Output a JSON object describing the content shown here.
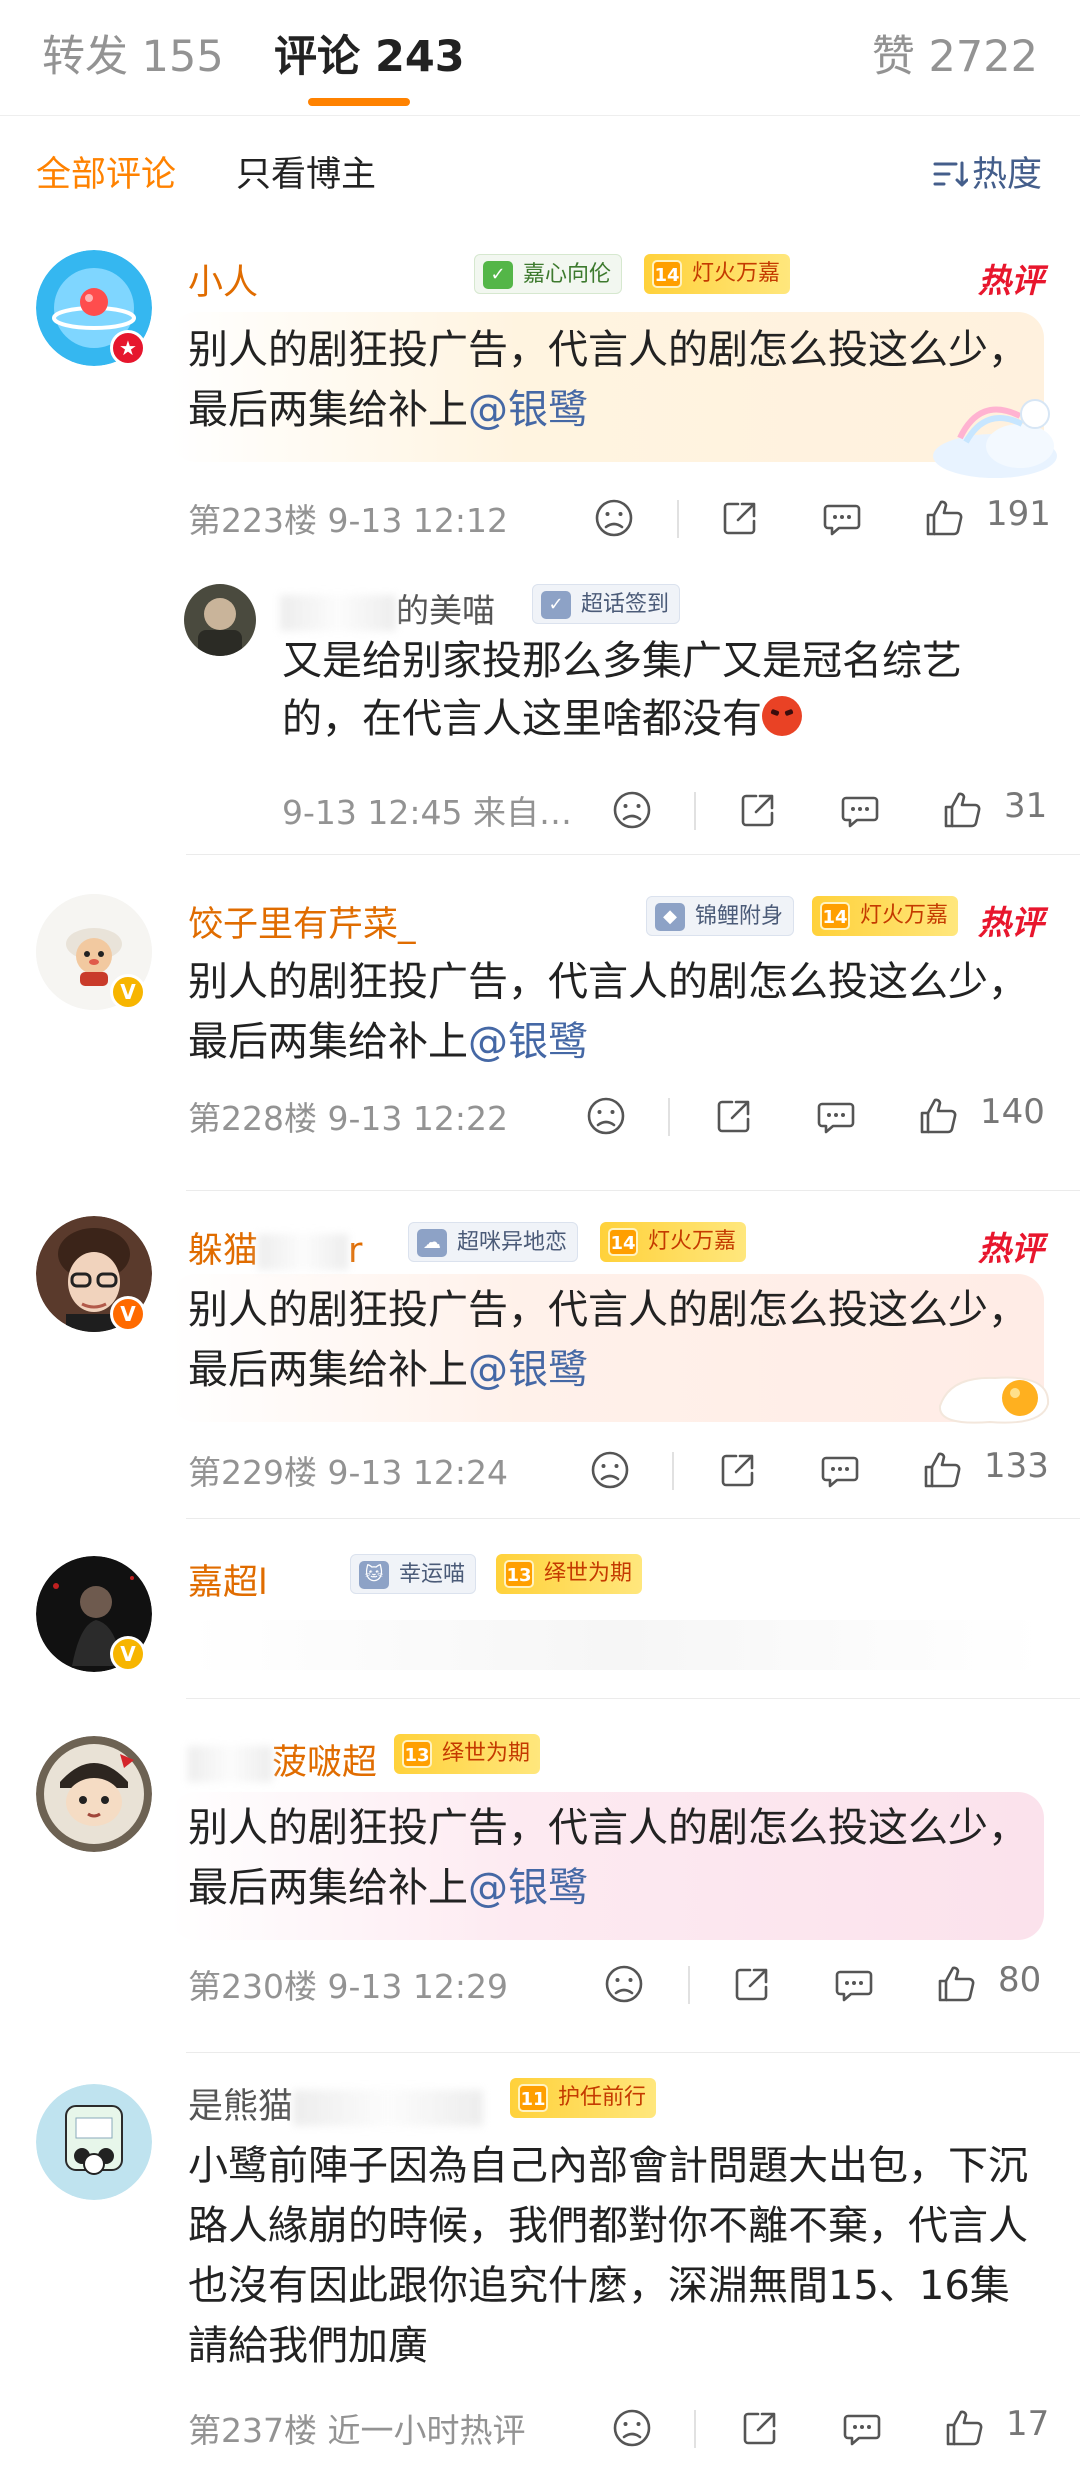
{
  "tabs": {
    "forward": "转发 155",
    "comments": "评论 243",
    "likes": "赞 2722"
  },
  "filter": {
    "all": "全部评论",
    "owner_only": "只看博主",
    "sort": "热度"
  },
  "mention": "@银鹭",
  "comments": [
    {
      "user": "小人",
      "tags": [
        {
          "icon": "check-calendar-icon",
          "label": "嘉心向伦",
          "style": "green"
        },
        {
          "icon": "level-14-icon",
          "level": "14",
          "label": "灯火万嘉",
          "style": "fire"
        }
      ],
      "hot_badge": "热评",
      "text_before": "别人的剧狂投广告，代言人的剧怎么投这么少，最后两集给补上",
      "floor": "第223楼",
      "time": "9-13 12:12",
      "likes": "191",
      "reply": {
        "user_visible": "的美喵",
        "tag": "超话签到",
        "text": "又是给别家投那么多集广又是冠名综艺的，在代言人这里啥都没有",
        "time": "9-13 12:45",
        "source": "来自…",
        "likes": "31"
      }
    },
    {
      "user": "饺子里有芹菜_",
      "tags": [
        {
          "icon": "koi-icon",
          "label": "锦鲤附身",
          "style": "gray"
        },
        {
          "icon": "level-14-icon",
          "level": "14",
          "label": "灯火万嘉",
          "style": "fire"
        }
      ],
      "hot_badge": "热评",
      "text_before": "别人的剧狂投广告，代言人的剧怎么投这么少，最后两集给补上",
      "floor": "第228楼",
      "time": "9-13 12:22",
      "likes": "140"
    },
    {
      "user_left": "躲猫",
      "user_right": "r",
      "tags": [
        {
          "icon": "cloud-icon",
          "label": "超咪异地恋",
          "style": "gray"
        },
        {
          "icon": "level-14-icon",
          "level": "14",
          "label": "灯火万嘉",
          "style": "fire"
        }
      ],
      "hot_badge": "热评",
      "text_before": "别人的剧狂投广告，代言人的剧怎么投这么少，最后两集给补上",
      "floor": "第229楼",
      "time": "9-13 12:24",
      "likes": "133"
    },
    {
      "user": "嘉超l",
      "tags": [
        {
          "icon": "cat-icon",
          "label": "幸运喵",
          "style": "gray"
        },
        {
          "icon": "level-13-icon",
          "level": "13",
          "label": "绎世为期",
          "style": "fire"
        }
      ]
    },
    {
      "user": "菠啵超",
      "tags": [
        {
          "icon": "level-13-icon",
          "level": "13",
          "label": "绎世为期",
          "style": "fire"
        }
      ],
      "text_before": "别人的剧狂投广告，代言人的剧怎么投这么少，最后两集给补上",
      "floor": "第230楼",
      "time": "9-13 12:29",
      "likes": "80"
    },
    {
      "user": "是熊猫",
      "tags": [
        {
          "icon": "level-11-icon",
          "level": "11",
          "label": "护任前行",
          "style": "fire"
        }
      ],
      "text": "小鹭前陣子因為自己內部會計問題大出包，下沉路人緣崩的時候，我們都對你不離不棄，代言人也沒有因此跟你追究什麼，深淵無間15、16集請給我們加廣",
      "floor": "第237楼",
      "time": "近一小时热评",
      "likes": "17"
    }
  ],
  "colors": {
    "accent": "#ff8200",
    "username": "#e06c00",
    "hot": "#e8162d",
    "link": "#4568a5",
    "meta": "#939393"
  }
}
